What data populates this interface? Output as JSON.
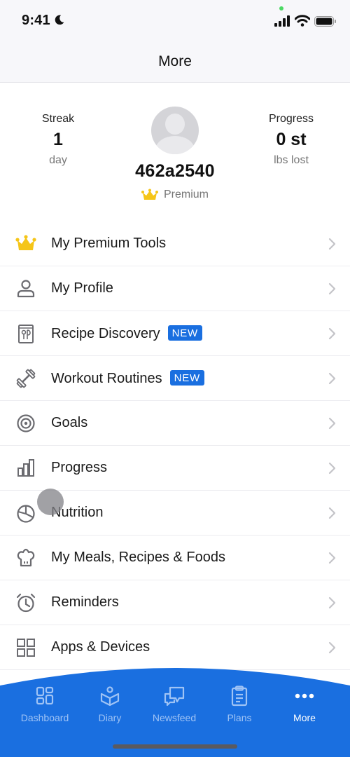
{
  "status_bar": {
    "time": "9:41",
    "focus_icon": "moon-icon",
    "icons": [
      "cellular-signal-icon",
      "wifi-icon",
      "battery-icon"
    ]
  },
  "header": {
    "title": "More"
  },
  "profile": {
    "streak": {
      "label": "Streak",
      "value": "1",
      "unit": "day"
    },
    "progress": {
      "label": "Progress",
      "value": "0 st",
      "unit": "lbs lost"
    },
    "username": "462a2540",
    "membership": "Premium",
    "avatar_icon": "default-avatar-icon"
  },
  "menu": {
    "items": [
      {
        "label": "My Premium Tools",
        "icon": "crown-icon",
        "badge": ""
      },
      {
        "label": "My Profile",
        "icon": "person-icon",
        "badge": ""
      },
      {
        "label": "Recipe Discovery",
        "icon": "recipe-book-icon",
        "badge": "NEW"
      },
      {
        "label": "Workout Routines",
        "icon": "dumbbell-icon",
        "badge": "NEW"
      },
      {
        "label": "Goals",
        "icon": "target-icon",
        "badge": ""
      },
      {
        "label": "Progress",
        "icon": "bar-chart-icon",
        "badge": ""
      },
      {
        "label": "Nutrition",
        "icon": "pie-chart-icon",
        "badge": ""
      },
      {
        "label": "My Meals, Recipes & Foods",
        "icon": "chef-hat-icon",
        "badge": ""
      },
      {
        "label": "Reminders",
        "icon": "alarm-clock-icon",
        "badge": ""
      },
      {
        "label": "Apps & Devices",
        "icon": "grid-icon",
        "badge": ""
      }
    ]
  },
  "tab_bar": {
    "tabs": [
      {
        "label": "Dashboard",
        "icon": "dashboard-icon",
        "active": false
      },
      {
        "label": "Diary",
        "icon": "diary-icon",
        "active": false
      },
      {
        "label": "Newsfeed",
        "icon": "newsfeed-icon",
        "active": false
      },
      {
        "label": "Plans",
        "icon": "clipboard-icon",
        "active": false
      },
      {
        "label": "More",
        "icon": "more-dots-icon",
        "active": true
      }
    ]
  },
  "colors": {
    "accent": "#1a6fe0",
    "premium_gold": "#f5c518",
    "icon_gray": "#6b6b70",
    "chevron_gray": "#c4c4c8"
  }
}
